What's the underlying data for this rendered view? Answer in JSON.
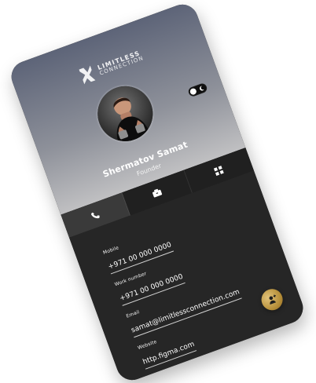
{
  "brand": {
    "line_1": "LIMITLESS",
    "line_2": "CONNECTION"
  },
  "profile": {
    "name": "Shermatov Samat",
    "role": "Founder"
  },
  "tabs": [
    {
      "icon": "phone-icon"
    },
    {
      "icon": "briefcase-icon"
    },
    {
      "icon": "grid-icon"
    }
  ],
  "fields": {
    "mobile": {
      "label": "Mobile",
      "value": "+971 00 000 0000"
    },
    "work": {
      "label": "Work number",
      "value": "+971 00 000 0000"
    },
    "email": {
      "label": "Email",
      "value": "samat@limitlessconnection.com"
    },
    "website": {
      "label": "Website",
      "value": "http.figma.com"
    }
  },
  "colors": {
    "accent": "#c7a24f",
    "card_dark": "#262626",
    "tab_active": "#3a3a3a"
  },
  "icons": {
    "brand": "limitless-logo-icon",
    "theme_toggle": "moon-icon",
    "fab": "contact-icon"
  }
}
